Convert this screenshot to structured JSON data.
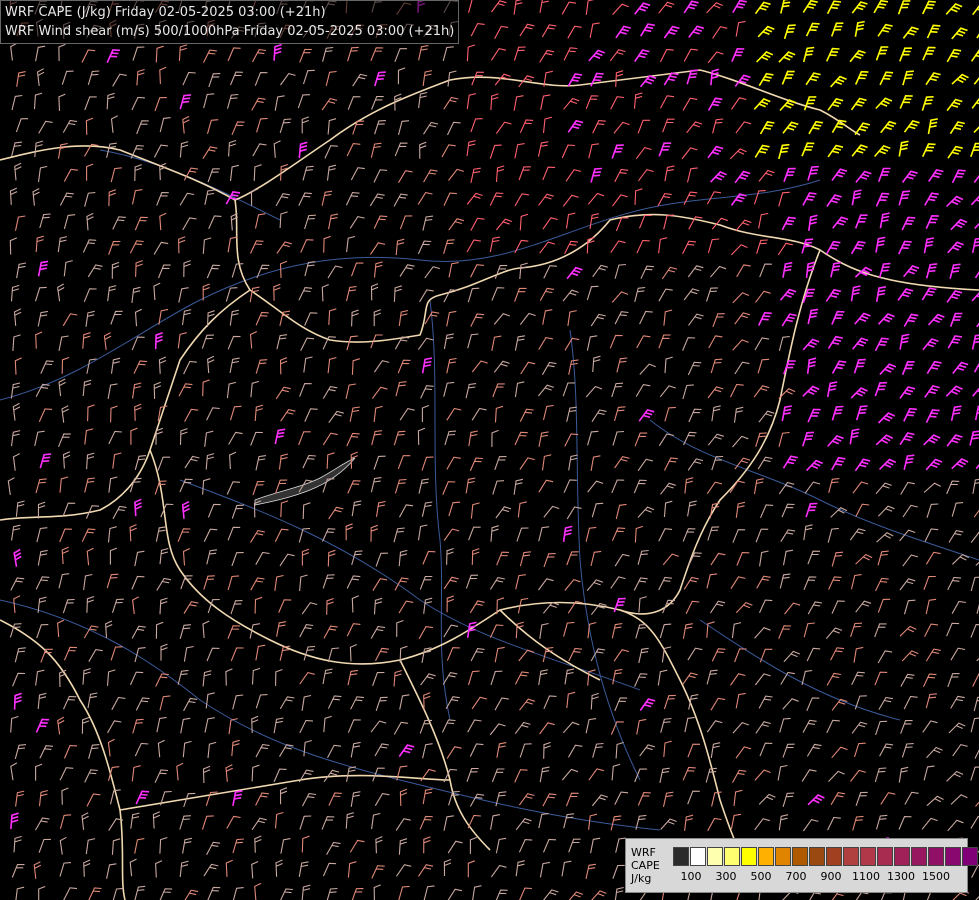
{
  "title": {
    "line1": "WRF CAPE (J/kg) Friday 02-05-2025 03:00 (+21h)",
    "line2": "WRF Wind shear (m/s) 500/1000hPa Friday 02-05-2025 03:00 (+21h)"
  },
  "legend": {
    "label_model": "WRF",
    "label_field": "CAPE",
    "label_unit": "J/kg",
    "swatch_colors": [
      "#2b2b2b",
      "#ffffff",
      "#ffffb0",
      "#ffff70",
      "#ffff00",
      "#ffb000",
      "#e08400",
      "#b05a00",
      "#9a4a10",
      "#a04020",
      "#b04040",
      "#b03848",
      "#a82c50",
      "#a02058",
      "#981860",
      "#901068",
      "#880870",
      "#800078"
    ],
    "tick_labels": [
      "100",
      "300",
      "500",
      "700",
      "900",
      "1100",
      "1300",
      "1500"
    ]
  },
  "colors": {
    "background": "#000000",
    "border": "#f0d8b0",
    "river": "#3a5a9a",
    "barb_low": "#c8a8a0",
    "barb_mid": "#e08878",
    "barb_high": "#ff6070",
    "barb_magenta": "#ff30ff",
    "barb_yellow": "#ffff00"
  }
}
